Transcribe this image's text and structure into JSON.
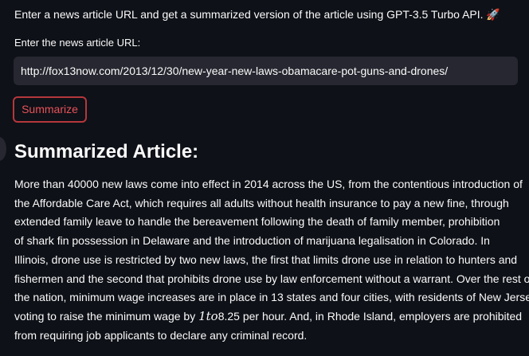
{
  "intro": {
    "text": "Enter a news article URL and get a summarized version of the article using GPT-3.5 Turbo API. 🚀"
  },
  "url_field": {
    "label": "Enter the news article URL:",
    "value": "http://fox13now.com/2013/12/30/new-year-new-laws-obamacare-pot-guns-and-drones/"
  },
  "summarize_button": {
    "label": "Summarize"
  },
  "result": {
    "title": "Summarized Article:",
    "lines": [
      "More than 40000 new laws come into effect in 2014 across the US, from the contentious introduction of",
      "the Affordable Care Act, which requires all adults without health insurance to pay a new fine, through",
      "extended family leave to handle the bereavement following the death of family member, prohibition",
      "of shark fin possession in Delaware and the introduction of marijuana legalisation in Colorado. In",
      "Illinois, drone use is restricted by two new laws, the first that limits drone use in relation to hunters and",
      "fishermen and the second that prohibits drone use by law enforcement without a warrant. Over the rest of",
      "the nation, minimum wage increases are in place in 13 states and four cities, with residents of New Jersey"
    ],
    "line8_start": "voting to raise the minimum wage by ",
    "line8_math": "1to",
    "line8_end": "8.25 per hour. And, in Rhode Island, employers are prohibited",
    "line9": "from requiring job applicants to declare any criminal record."
  }
}
